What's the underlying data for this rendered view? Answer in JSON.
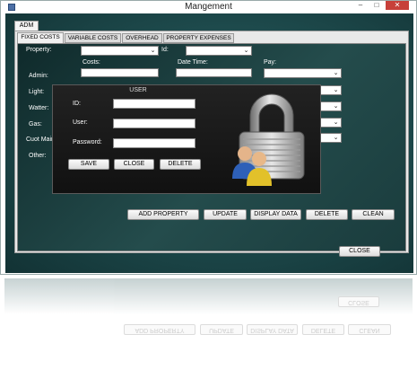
{
  "window": {
    "title": "Mangement"
  },
  "outer_tab": "ADM",
  "tabs": [
    {
      "label": "FIXED COSTS",
      "active": true
    },
    {
      "label": "VARIABLE COSTS",
      "active": false
    },
    {
      "label": "OVERHEAD",
      "active": false
    },
    {
      "label": "PROPERTY EXPENSES",
      "active": false
    }
  ],
  "form": {
    "property_label": "Property:",
    "id_label": "Id:",
    "costs_label": "Costs:",
    "datetime_label": "Date Time:",
    "pay_label": "Pay:",
    "admin_label": "Admin:",
    "light_label": "Light:",
    "water_label": "Watter:",
    "gas_label": "Gas:",
    "maint_label": "Cuot Maint:",
    "other_label": "Other:"
  },
  "user_dialog": {
    "title": "USER",
    "id_label": "ID:",
    "user_label": "User:",
    "password_label": "Password:",
    "save": "SAVE",
    "close": "CLOSE",
    "delete": "DELETE"
  },
  "actions": {
    "add_property": "ADD PROPERTY",
    "update": "UPDATE",
    "display_data": "DISPLAY DATA",
    "delete": "DELETE",
    "clean": "CLEAN"
  },
  "close_button": "CLOSE",
  "colors": {
    "background_teal": "#1f4d4f",
    "close_red": "#c7403a"
  }
}
